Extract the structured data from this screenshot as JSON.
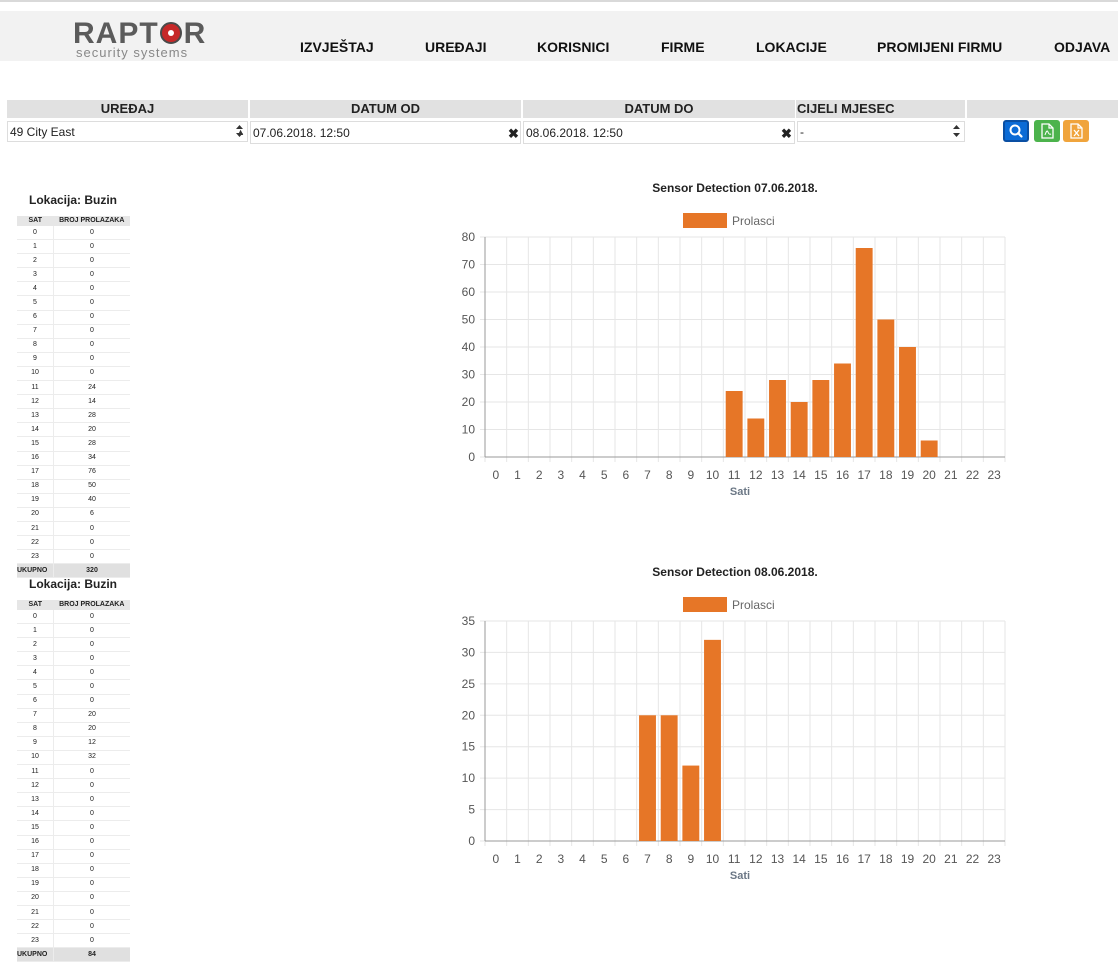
{
  "brand": {
    "name_prefix": "RAPT",
    "name_suffix": "R",
    "tagline": "security systems"
  },
  "nav": {
    "items": [
      "IZVJEŠTAJ",
      "UREĐAJI",
      "KORISNICI",
      "FIRME",
      "LOKACIJE",
      "PROMIJENI FIRMU",
      "ODJAVA"
    ]
  },
  "filters": {
    "device_label": "UREĐAJ",
    "date_from_label": "DATUM OD",
    "date_to_label": "DATUM DO",
    "month_label": "CIJELI MJESEC",
    "device_value": "49 City East",
    "date_from_value": "07.06.2018. 12:50",
    "date_to_value": "08.06.2018. 12:50",
    "month_value": "-"
  },
  "colors": {
    "bar": "#e67627",
    "search_btn": "#0b6bd6",
    "pdf_btn": "#4cb34c",
    "excel_btn": "#f0a43c"
  },
  "reports": [
    {
      "location_label": "Lokacija: Buzin",
      "col_hour": "SAT",
      "col_count": "BROJ PROLAZAKA",
      "hours": [
        "0",
        "1",
        "2",
        "3",
        "4",
        "5",
        "6",
        "7",
        "8",
        "9",
        "10",
        "11",
        "12",
        "13",
        "14",
        "15",
        "16",
        "17",
        "18",
        "19",
        "20",
        "21",
        "22",
        "23"
      ],
      "counts": [
        "0",
        "0",
        "0",
        "0",
        "0",
        "0",
        "0",
        "0",
        "0",
        "0",
        "0",
        "24",
        "14",
        "28",
        "20",
        "28",
        "34",
        "76",
        "50",
        "40",
        "6",
        "0",
        "0",
        "0"
      ],
      "total_label": "UKUPNO",
      "total": "320"
    },
    {
      "location_label": "Lokacija: Buzin",
      "col_hour": "SAT",
      "col_count": "BROJ PROLAZAKA",
      "hours": [
        "0",
        "1",
        "2",
        "3",
        "4",
        "5",
        "6",
        "7",
        "8",
        "9",
        "10",
        "11",
        "12",
        "13",
        "14",
        "15",
        "16",
        "17",
        "18",
        "19",
        "20",
        "21",
        "22",
        "23"
      ],
      "counts": [
        "0",
        "0",
        "0",
        "0",
        "0",
        "0",
        "0",
        "20",
        "20",
        "12",
        "32",
        "0",
        "0",
        "0",
        "0",
        "0",
        "0",
        "0",
        "0",
        "0",
        "0",
        "0",
        "0",
        "0"
      ],
      "total_label": "UKUPNO",
      "total": "84"
    }
  ],
  "chart_data": [
    {
      "type": "bar",
      "title": "Sensor Detection 07.06.2018.",
      "legend": "Prolasci",
      "xlabel": "Sati",
      "ylabel": "",
      "categories": [
        "0",
        "1",
        "2",
        "3",
        "4",
        "5",
        "6",
        "7",
        "8",
        "9",
        "10",
        "11",
        "12",
        "13",
        "14",
        "15",
        "16",
        "17",
        "18",
        "19",
        "20",
        "21",
        "22",
        "23"
      ],
      "values": [
        0,
        0,
        0,
        0,
        0,
        0,
        0,
        0,
        0,
        0,
        0,
        24,
        14,
        28,
        20,
        28,
        34,
        76,
        50,
        40,
        6,
        0,
        0,
        0
      ],
      "ylim": [
        0,
        80
      ],
      "yticks": [
        0,
        10,
        20,
        30,
        40,
        50,
        60,
        70,
        80
      ],
      "grid": true,
      "legend_position": "top"
    },
    {
      "type": "bar",
      "title": "Sensor Detection 08.06.2018.",
      "legend": "Prolasci",
      "xlabel": "Sati",
      "ylabel": "",
      "categories": [
        "0",
        "1",
        "2",
        "3",
        "4",
        "5",
        "6",
        "7",
        "8",
        "9",
        "10",
        "11",
        "12",
        "13",
        "14",
        "15",
        "16",
        "17",
        "18",
        "19",
        "20",
        "21",
        "22",
        "23"
      ],
      "values": [
        0,
        0,
        0,
        0,
        0,
        0,
        0,
        20,
        20,
        12,
        32,
        0,
        0,
        0,
        0,
        0,
        0,
        0,
        0,
        0,
        0,
        0,
        0,
        0
      ],
      "ylim": [
        0,
        35
      ],
      "yticks": [
        0,
        5,
        10,
        15,
        20,
        25,
        30,
        35
      ],
      "grid": true,
      "legend_position": "top"
    }
  ]
}
